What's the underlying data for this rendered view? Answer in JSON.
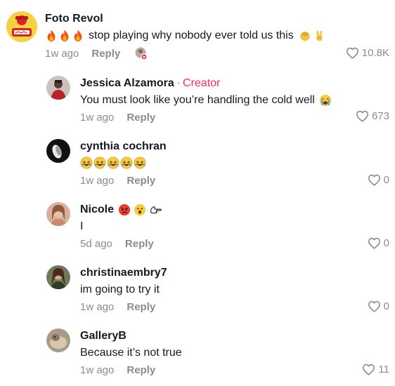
{
  "comments": [
    {
      "username": "Foto Revol",
      "text": "stop playing why nobody ever told us this",
      "time": "1w ago",
      "reply": "Reply",
      "likes": "10.8K"
    },
    {
      "username": "Jessica Alzamora",
      "creator_label": "Creator",
      "creator_dot": "·",
      "text": "You must look like you’re handling the cold well",
      "time": "1w ago",
      "reply": "Reply",
      "likes": "673"
    },
    {
      "username": "cynthia cochran",
      "text": "",
      "time": "1w ago",
      "reply": "Reply",
      "likes": "0"
    },
    {
      "username": "Nicole",
      "text": "I",
      "time": "5d ago",
      "reply": "Reply",
      "likes": "0"
    },
    {
      "username": "christinaembry7",
      "text": "im going to try it",
      "time": "1w ago",
      "reply": "Reply",
      "likes": "0"
    },
    {
      "username": "GalleryB",
      "text": "Because it’s not true",
      "time": "1w ago",
      "reply": "Reply",
      "likes": "11"
    }
  ],
  "icons": {
    "like": "heart-outline-icon",
    "fire": "fire-emoji",
    "clap": "clapping-hands-emoji",
    "victory": "victory-hand-emoji",
    "crying": "loudly-crying-emoji",
    "laughing": "rolling-laughing-emoji",
    "angry": "angry-face-emoji",
    "surprised": "astonished-face-emoji",
    "pointing": "pointing-hand-emoji"
  },
  "colors": {
    "accent": "#fe2c55",
    "muted": "#8a8b91",
    "text": "#161823"
  }
}
